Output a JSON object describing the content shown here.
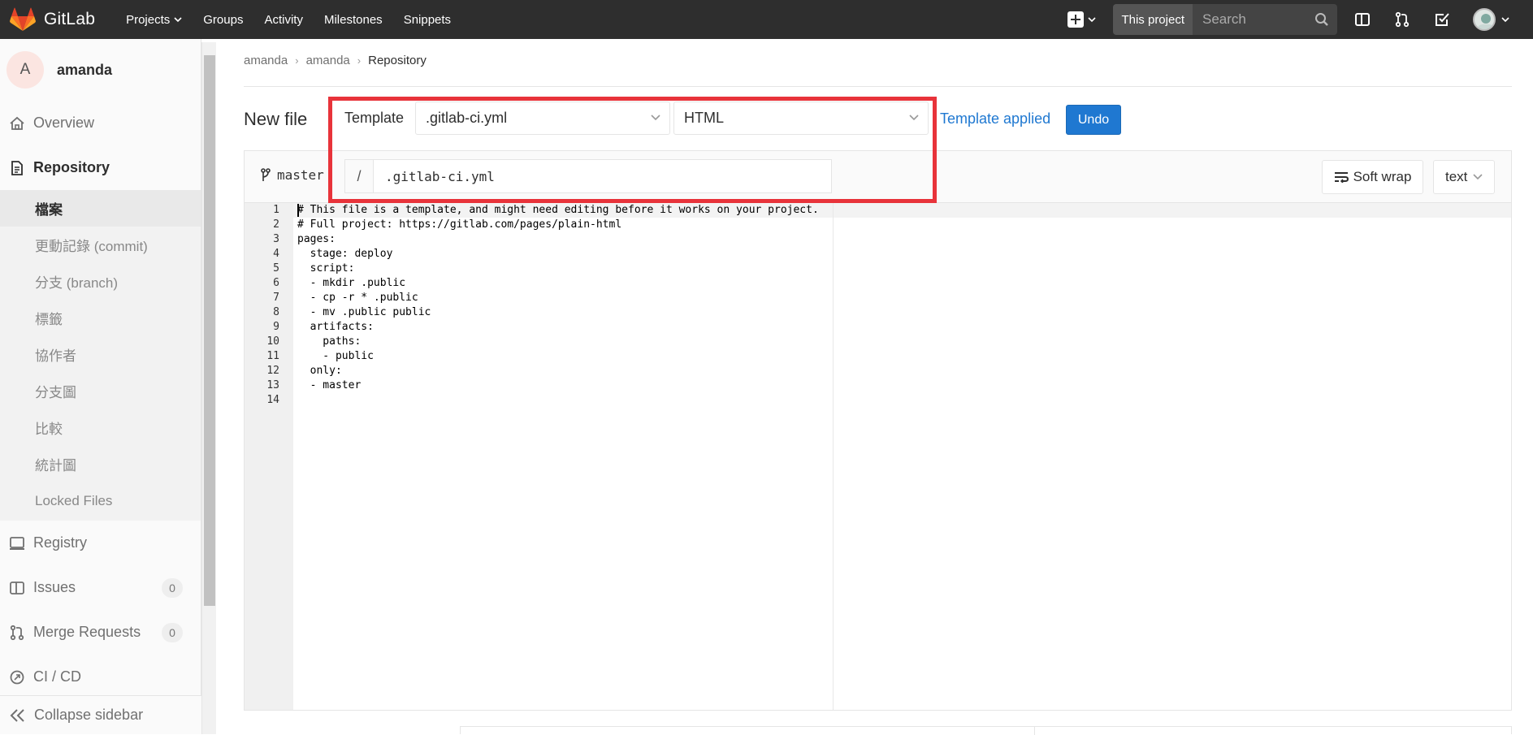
{
  "app": {
    "name": "GitLab"
  },
  "nav": {
    "links": [
      "Projects",
      "Groups",
      "Activity",
      "Milestones",
      "Snippets"
    ],
    "search_scope": "This project",
    "search_placeholder": "Search"
  },
  "sidebar": {
    "project_initial": "A",
    "project_name": "amanda",
    "items": [
      {
        "label": "Overview",
        "icon": "home-icon"
      },
      {
        "label": "Repository",
        "icon": "document-icon"
      }
    ],
    "sub_items": [
      "檔案",
      "更動記錄 (commit)",
      "分支 (branch)",
      "標籤",
      "協作者",
      "分支圖",
      "比較",
      "統計圖",
      "Locked Files"
    ],
    "lower_items": [
      {
        "label": "Registry",
        "icon": "container-icon"
      },
      {
        "label": "Issues",
        "icon": "issues-icon",
        "count": "0"
      },
      {
        "label": "Merge Requests",
        "icon": "merge-request-icon",
        "count": "0"
      },
      {
        "label": "CI / CD",
        "icon": "rocket-icon"
      }
    ],
    "collapse_label": "Collapse sidebar"
  },
  "breadcrumb": [
    "amanda",
    "amanda",
    "Repository"
  ],
  "page": {
    "title": "New file",
    "template_label": "Template",
    "template_type": ".gitlab-ci.yml",
    "template_name": "HTML",
    "template_status": "Template applied",
    "undo_label": "Undo",
    "branch": "master",
    "path_slash": "/",
    "file_name": ".gitlab-ci.yml",
    "soft_wrap_label": "Soft wrap",
    "language": "text"
  },
  "code": {
    "line_numbers": [
      "1",
      "2",
      "3",
      "4",
      "5",
      "6",
      "7",
      "8",
      "9",
      "10",
      "11",
      "12",
      "13",
      "14"
    ],
    "lines": [
      "# This file is a template, and might need editing before it works on your project.",
      "# Full project: https://gitlab.com/pages/plain-html",
      "pages:",
      "  stage: deploy",
      "  script:",
      "  - mkdir .public",
      "  - cp -r * .public",
      "  - mv .public public",
      "  artifacts:",
      "    paths:",
      "    - public",
      "  only:",
      "  - master",
      ""
    ]
  },
  "colors": {
    "accent": "#1f78d1",
    "highlight": "#e8333a",
    "topbar": "#2e2e2e"
  }
}
